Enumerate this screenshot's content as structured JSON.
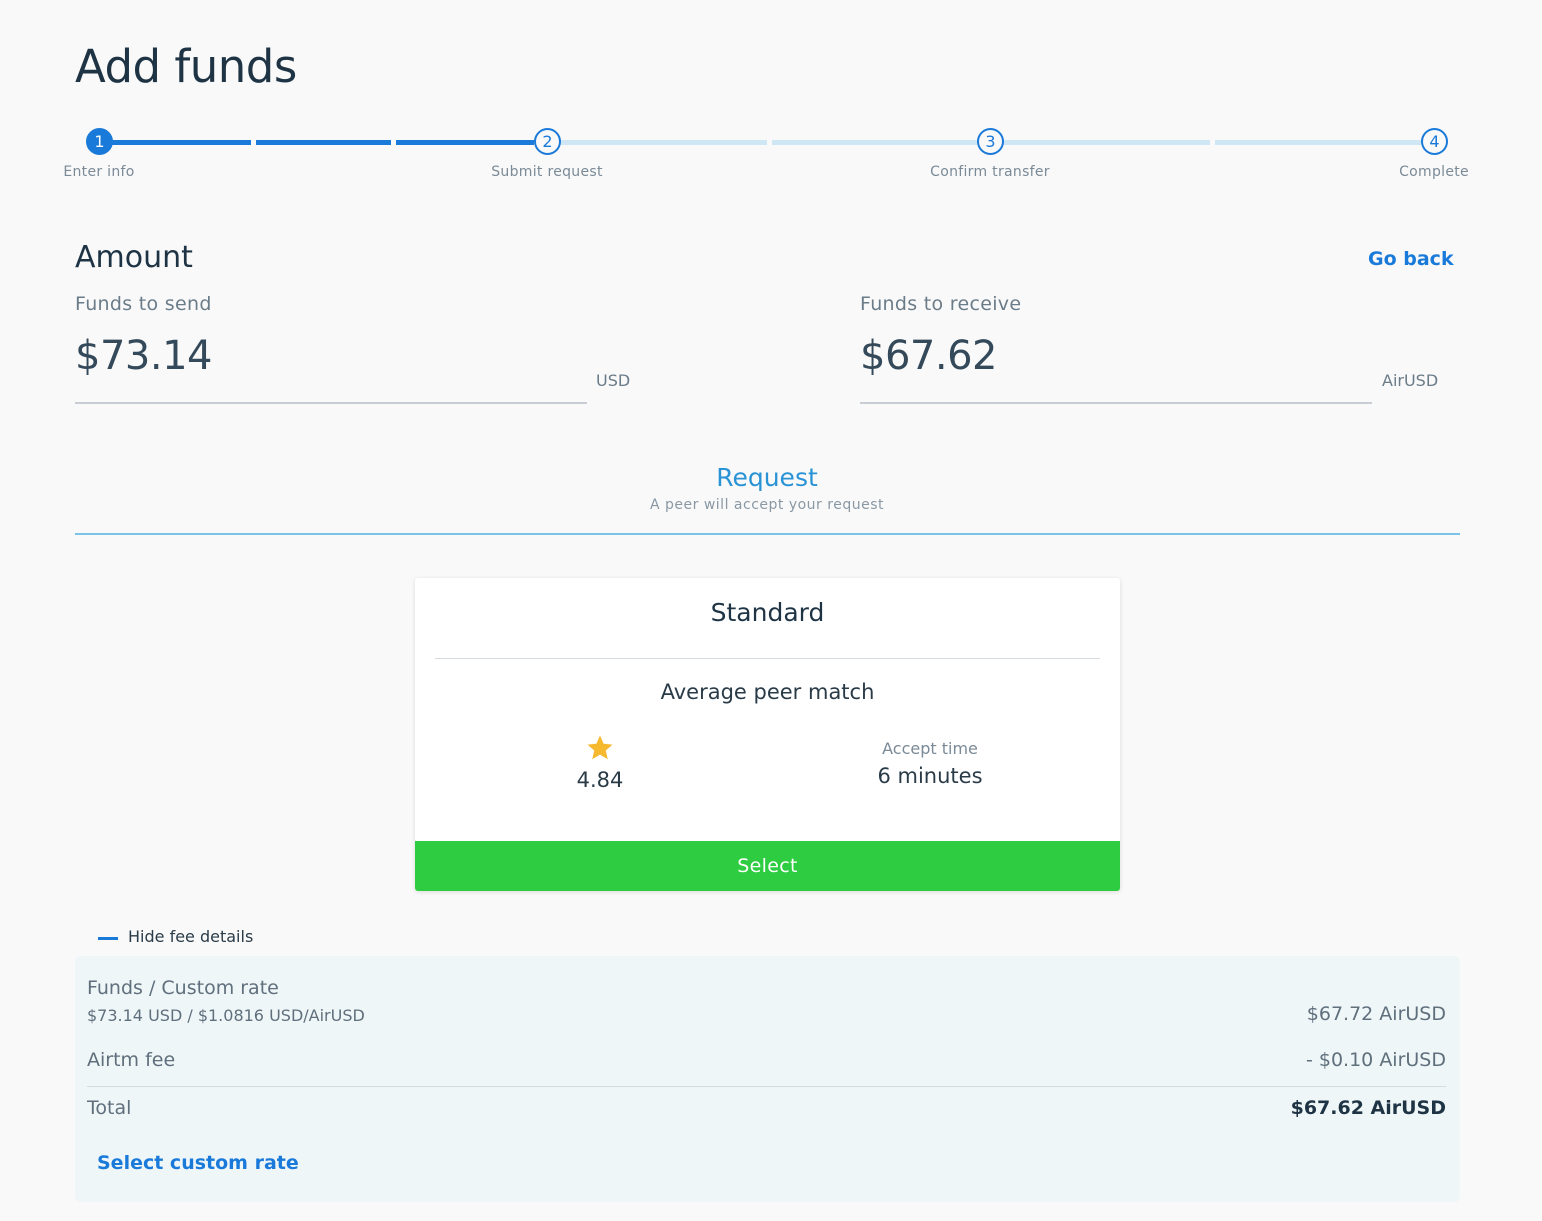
{
  "page": {
    "title": "Add funds"
  },
  "stepper": {
    "steps": [
      {
        "number": "1",
        "label": "Enter info"
      },
      {
        "number": "2",
        "label": "Submit request"
      },
      {
        "number": "3",
        "label": "Confirm transfer"
      },
      {
        "number": "4",
        "label": "Complete"
      }
    ],
    "current_step": 1
  },
  "amount": {
    "title": "Amount",
    "go_back": "Go back",
    "send": {
      "label": "Funds to send",
      "value": "$73.14",
      "currency": "USD"
    },
    "receive": {
      "label": "Funds to receive",
      "value": "$67.62",
      "currency": "AirUSD"
    }
  },
  "request": {
    "title": "Request",
    "subtitle": "A peer will accept your request"
  },
  "card": {
    "title": "Standard",
    "subtitle": "Average peer match",
    "rating": "4.84",
    "rating_icon": "star-icon",
    "accept_label": "Accept time",
    "accept_value": "6 minutes",
    "select_label": "Select"
  },
  "fees": {
    "toggle_label": "Hide fee details",
    "rows": {
      "funds_label": "Funds / Custom rate",
      "funds_sub": "$73.14 USD / $1.0816 USD/AirUSD",
      "funds_value": "$67.72 AirUSD",
      "fee_label": "Airtm fee",
      "fee_value": "- $0.10 AirUSD",
      "total_label": "Total",
      "total_value": "$67.62 AirUSD"
    },
    "custom_rate_label": "Select custom rate"
  },
  "colors": {
    "accent": "#1a7ad9",
    "select_button": "#2ecc40",
    "star": "#f5b82e",
    "panel": "#eff6f8"
  }
}
